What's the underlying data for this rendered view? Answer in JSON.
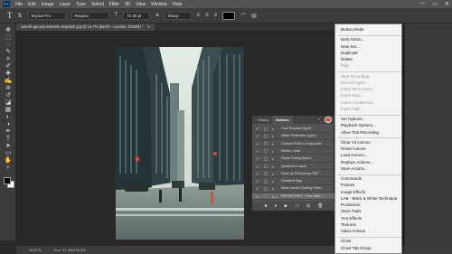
{
  "menubar": {
    "logo": "Ps",
    "items": [
      "File",
      "Edit",
      "Image",
      "Layer",
      "Type",
      "Select",
      "Filter",
      "3D",
      "View",
      "Window",
      "Help"
    ],
    "window_controls": [
      "—",
      "▭",
      "✕"
    ]
  },
  "options_bar": {
    "tool_glyph": "T",
    "font_family": "Myriad Pro",
    "font_style": "Regular",
    "font_size": "72.38 pt",
    "aa_mode": "Sharp",
    "text_color": "#000000"
  },
  "document_tab": {
    "title": "saketh-garuda-368198-unsplash.jpg @ 16.7% (Berlin - London, RGB/8) *",
    "close": "✕"
  },
  "toolbar": {
    "tools": [
      "move-tool",
      "marquee-tool",
      "lasso-tool",
      "quick-select-tool",
      "crop-tool",
      "eyedropper-tool",
      "healing-tool",
      "brush-tool",
      "clone-tool",
      "history-brush-tool",
      "eraser-tool",
      "gradient-tool",
      "blur-tool",
      "dodge-tool",
      "pen-tool",
      "type-tool",
      "path-select-tool",
      "shape-tool",
      "hand-tool",
      "zoom-tool"
    ],
    "foreground_color": "#000000",
    "background_color": "#ffffff"
  },
  "status_bar": {
    "zoom": "16.67%",
    "doc_size": "Doc: 31.3M/235.1M"
  },
  "actions_panel": {
    "tabs": [
      "History",
      "Actions"
    ],
    "active_tab": "Actions",
    "rows": [
      {
        "name": "Cast Shadow (type)",
        "checked": true,
        "folder": false
      },
      {
        "name": "Water Reflection (type)",
        "checked": true,
        "folder": false
      },
      {
        "name": "Custom RGB to Grayscale",
        "checked": true,
        "folder": false
      },
      {
        "name": "Molten Lead",
        "checked": true,
        "folder": false
      },
      {
        "name": "Sepia Toning (layer)",
        "checked": true,
        "folder": false
      },
      {
        "name": "Quadrant Colors",
        "checked": true,
        "folder": false
      },
      {
        "name": "Save as Photoshop PDF",
        "checked": true,
        "folder": false
      },
      {
        "name": "Gradient Map",
        "checked": true,
        "folder": false
      },
      {
        "name": "Mixer Brush Cloning Paint...",
        "checked": true,
        "folder": false
      },
      {
        "name": "PRESETPRO - Free Sale...",
        "checked": true,
        "folder": true
      }
    ],
    "bottom_icons": [
      "stop-icon",
      "record-icon",
      "play-icon",
      "new-set-icon",
      "new-action-icon",
      "delete-icon"
    ],
    "menu_glyph": "≡",
    "collapse_glyph": "»"
  },
  "flyout_menu": {
    "items": [
      {
        "label": "Button Mode",
        "disabled": false
      },
      {
        "sep": true
      },
      {
        "label": "New Action...",
        "disabled": false
      },
      {
        "label": "New Set...",
        "disabled": false
      },
      {
        "label": "Duplicate",
        "disabled": false
      },
      {
        "label": "Delete",
        "disabled": false
      },
      {
        "label": "Play",
        "disabled": true
      },
      {
        "sep": true
      },
      {
        "label": "Start Recording",
        "disabled": true
      },
      {
        "label": "Record Again...",
        "disabled": true
      },
      {
        "label": "Insert Menu Item...",
        "disabled": true
      },
      {
        "label": "Insert Stop...",
        "disabled": true
      },
      {
        "label": "Insert Conditional...",
        "disabled": true
      },
      {
        "label": "Insert Path",
        "disabled": true
      },
      {
        "sep": true
      },
      {
        "label": "Set Options...",
        "disabled": false
      },
      {
        "label": "Playback Options...",
        "disabled": false
      },
      {
        "label": "Allow Tool Recording",
        "disabled": false
      },
      {
        "sep": true
      },
      {
        "label": "Clear All Actions",
        "disabled": false
      },
      {
        "label": "Reset Actions",
        "disabled": false
      },
      {
        "label": "Load Actions...",
        "disabled": false
      },
      {
        "label": "Replace Actions...",
        "disabled": false
      },
      {
        "label": "Save Actions...",
        "disabled": false
      },
      {
        "sep": true
      },
      {
        "label": "Commands",
        "disabled": false
      },
      {
        "label": "Frames",
        "disabled": false
      },
      {
        "label": "Image Effects",
        "disabled": false
      },
      {
        "label": "LAB - Black & White Technique",
        "disabled": false
      },
      {
        "label": "Production",
        "disabled": false
      },
      {
        "label": "Stars Trails",
        "disabled": false
      },
      {
        "label": "Text Effects",
        "disabled": false
      },
      {
        "label": "Textures",
        "disabled": false
      },
      {
        "label": "Video Actions",
        "disabled": false
      },
      {
        "sep": true
      },
      {
        "label": "Close",
        "disabled": false
      },
      {
        "label": "Close Tab Group",
        "disabled": false
      }
    ]
  }
}
